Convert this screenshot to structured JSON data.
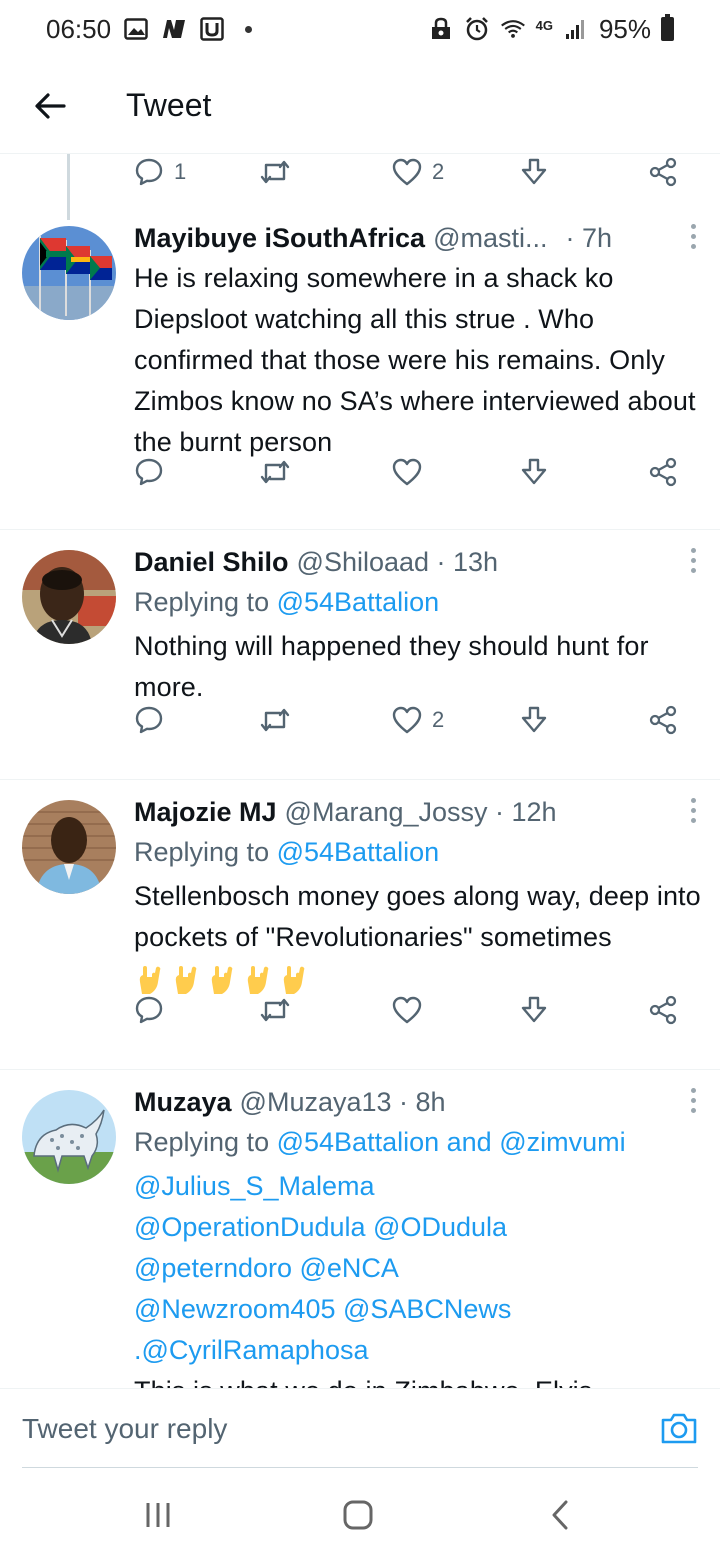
{
  "status": {
    "time": "06:50",
    "network": "4G",
    "battery": "95%"
  },
  "header": {
    "title": "Tweet"
  },
  "top_actions": {
    "reply_count": "1",
    "like_count": "2"
  },
  "tweets": [
    {
      "name": "Mayibuye iSouthAfrica",
      "handle": "@masti...",
      "time": "· 7h",
      "reply_prefix": "",
      "reply_to": "",
      "text": "He is relaxing somewhere in a shack ko Diepsloot watching all this strue . Who confirmed that those were his remains. Only Zimbos know no SA’s where interviewed about the burnt person",
      "like_count": ""
    },
    {
      "name": "Daniel Shilo",
      "handle": "@Shiloaad · 13h",
      "reply_prefix": "Replying to",
      "reply_to": "@54Battalion",
      "text": "Nothing will happened they should hunt for more.",
      "like_count": "2"
    },
    {
      "name": "Majozie MJ",
      "handle": "@Marang_Jossy · 12h",
      "reply_prefix": "Replying to",
      "reply_to": "@54Battalion",
      "text": "Stellenbosch money goes along way, deep into pockets of \"Revolutionaries\" sometimes",
      "like_count": ""
    },
    {
      "name": "Muzaya",
      "handle": "@Muzaya13 · 8h",
      "reply_prefix": "Replying to",
      "reply_to": "@54Battalion",
      "reply_and": "and",
      "reply_to_2": "@zimvumi",
      "mentions": "@Julius_S_Malema @OperationDudula @ODudula @peterndoro @eNCA @Newzroom405 @SABCNews .@CyrilRamaphosa",
      "text": "This is what we do in Zimbabwe. Elvis",
      "like_count": ""
    }
  ],
  "reply_bar": {
    "placeholder": "Tweet your reply"
  },
  "icons": {
    "accent": "#1d9bf0",
    "muted": "#536471"
  }
}
